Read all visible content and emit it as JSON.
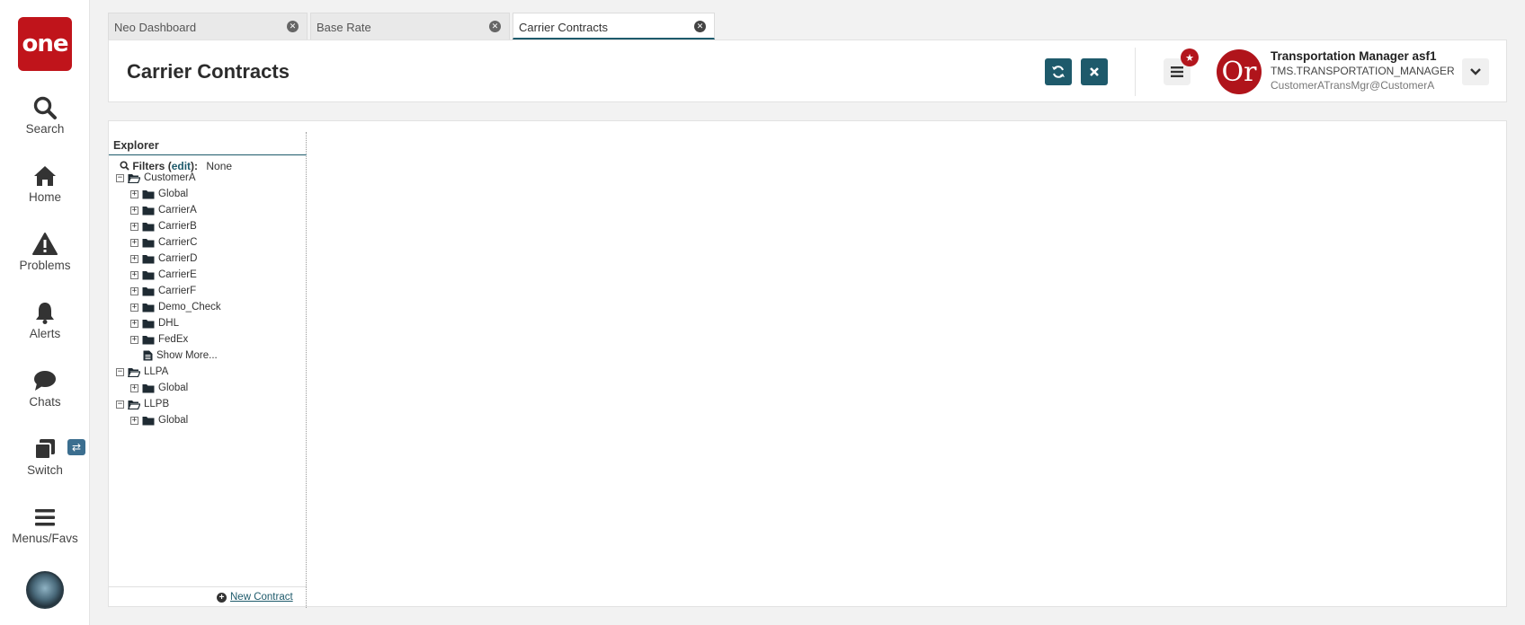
{
  "nav": {
    "logo": "one",
    "items": [
      {
        "label": "Search",
        "icon": "search-icon"
      },
      {
        "label": "Home",
        "icon": "home-icon"
      },
      {
        "label": "Problems",
        "icon": "warning-icon"
      },
      {
        "label": "Alerts",
        "icon": "bell-icon"
      },
      {
        "label": "Chats",
        "icon": "chat-icon"
      },
      {
        "label": "Switch",
        "icon": "switch-icon"
      },
      {
        "label": "Menus/Favs",
        "icon": "menu-icon"
      }
    ],
    "switch_badge": "⇄"
  },
  "tabs": [
    {
      "label": "Neo Dashboard",
      "active": false
    },
    {
      "label": "Base Rate",
      "active": false
    },
    {
      "label": "Carrier Contracts",
      "active": true
    }
  ],
  "header": {
    "title": "Carrier Contracts",
    "user": {
      "name": "Transportation Manager asf1",
      "role": "TMS.TRANSPORTATION_MANAGER",
      "email": "CustomerATransMgr@CustomerA",
      "avatar_text": "Or"
    }
  },
  "explorer": {
    "title": "Explorer",
    "filters_label": "Filters",
    "filters_edit": "edit",
    "filters_value": "None",
    "tree": [
      {
        "label": "CustomerA",
        "level": 0,
        "expanded": true,
        "type": "folder-open"
      },
      {
        "label": "Global",
        "level": 1,
        "expanded": false,
        "type": "folder"
      },
      {
        "label": "CarrierA",
        "level": 1,
        "expanded": false,
        "type": "folder"
      },
      {
        "label": "CarrierB",
        "level": 1,
        "expanded": false,
        "type": "folder"
      },
      {
        "label": "CarrierC",
        "level": 1,
        "expanded": false,
        "type": "folder"
      },
      {
        "label": "CarrierD",
        "level": 1,
        "expanded": false,
        "type": "folder"
      },
      {
        "label": "CarrierE",
        "level": 1,
        "expanded": false,
        "type": "folder"
      },
      {
        "label": "CarrierF",
        "level": 1,
        "expanded": false,
        "type": "folder"
      },
      {
        "label": "Demo_Check",
        "level": 1,
        "expanded": false,
        "type": "folder"
      },
      {
        "label": "DHL",
        "level": 1,
        "expanded": false,
        "type": "folder"
      },
      {
        "label": "FedEx",
        "level": 1,
        "expanded": false,
        "type": "folder"
      },
      {
        "label": "Show More...",
        "level": 1,
        "expanded": null,
        "type": "document"
      },
      {
        "label": "LLPA",
        "level": 0,
        "expanded": true,
        "type": "folder-open"
      },
      {
        "label": "Global",
        "level": 1,
        "expanded": false,
        "type": "folder"
      },
      {
        "label": "LLPB",
        "level": 0,
        "expanded": true,
        "type": "folder-open"
      },
      {
        "label": "Global",
        "level": 1,
        "expanded": false,
        "type": "folder"
      }
    ],
    "new_contract": "New Contract"
  },
  "colors": {
    "brand_red": "#c0141b",
    "accent_teal": "#1e5a6b"
  }
}
